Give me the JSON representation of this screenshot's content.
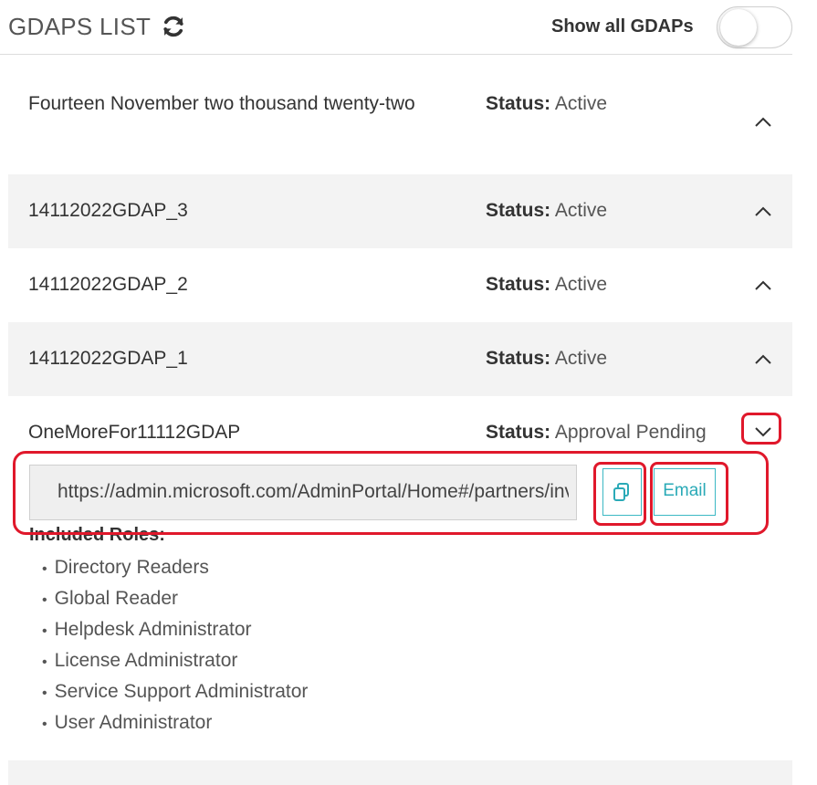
{
  "header": {
    "title": "GDAPS LIST",
    "refresh_icon": "refresh-icon",
    "toggle_label": "Show all GDAPs",
    "toggle_on": false
  },
  "status_label": "Status:",
  "gdaps": [
    {
      "name": "Fourteen November two thousand twenty-two",
      "status": "Active",
      "chevron": "up"
    },
    {
      "name": "14112022GDAP_3",
      "status": "Active",
      "chevron": "up"
    },
    {
      "name": "14112022GDAP_2",
      "status": "Active",
      "chevron": "up"
    },
    {
      "name": "14112022GDAP_1",
      "status": "Active",
      "chevron": "up"
    },
    {
      "name": "OneMoreFor11112GDAP",
      "status": "Approval Pending",
      "chevron": "down"
    }
  ],
  "expanded": {
    "url": "https://admin.microsoft.com/AdminPortal/Home#/partners/invitation/granularAdminRelationships",
    "copy_icon": "copy-icon",
    "email_label": "Email",
    "roles_heading": "Included Roles:",
    "roles": [
      "Directory Readers",
      "Global Reader",
      "Helpdesk Administrator",
      "License Administrator",
      "Service Support Administrator",
      "User Administrator"
    ]
  },
  "colors": {
    "accent": "#3bb8c4",
    "highlight": "#e0182b",
    "row_shade": "#f3f3f3"
  }
}
